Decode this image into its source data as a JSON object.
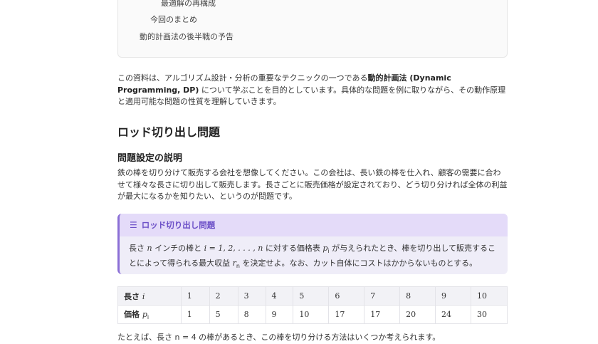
{
  "toc": {
    "items": [
      {
        "label": "最適解の再構成",
        "level": 3
      },
      {
        "label": "今回のまとめ",
        "level": 2
      },
      {
        "label": "動的計画法の後半戦の予告",
        "level": 1
      }
    ]
  },
  "intro": {
    "before": "この資料は、アルゴリズム設計・分析の重要なテクニックの一つである",
    "bold": "動的計画法 (Dynamic Programming, DP)",
    "after": " について学ぶことを目的としています。具体的な問題を例に取りながら、その動作原理と適用可能な問題の性質を理解していきます。"
  },
  "section": {
    "title": "ロッド切り出し問題",
    "subtitle": "問題設定の説明",
    "paragraph": "鉄の棒を切り分けて販売する会社を想像してください。この会社は、長い鉄の棒を仕入れ、顧客の需要に合わせて様々な長さに切り出して販売します。長さごとに販売価格が設定されており、どう切り分ければ全体の利益が最大になるかを知りたい、というのが問題です。"
  },
  "callout": {
    "title": "ロッド切り出し問題",
    "parts": [
      "長さ ",
      "n",
      " インチの棒と ",
      "i = 1, 2, . . . , n",
      " に対する価格表 ",
      "p",
      "i",
      " が与えられたとき、棒を切り出して販売することによって得られる最大収益 ",
      "r",
      "n",
      " を決定せよ。なお、カット自体にコストはかからないものとする。"
    ]
  },
  "table": {
    "row1_label": "長さ",
    "row1_var": "i",
    "row2_label": "価格",
    "row2_var": "p",
    "row2_sub": "i",
    "lengths": [
      "1",
      "2",
      "3",
      "4",
      "5",
      "6",
      "7",
      "8",
      "9",
      "10"
    ],
    "prices": [
      "1",
      "5",
      "8",
      "9",
      "10",
      "17",
      "17",
      "20",
      "24",
      "30"
    ]
  },
  "footer_text": "たとえば、長さ n = 4 の棒があるとき、この棒を切り分ける方法はいくつか考えられます。"
}
